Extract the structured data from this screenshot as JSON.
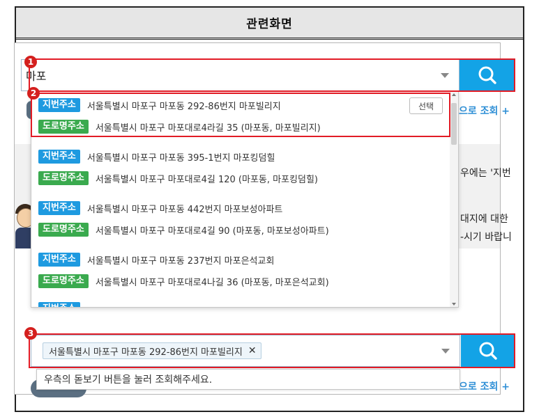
{
  "header": {
    "title": "관련화면"
  },
  "search": {
    "query": "마포"
  },
  "markers": [
    "1",
    "2",
    "3"
  ],
  "results": [
    {
      "jibun_label": "지번주소",
      "jibun": "서울특별시 마포구 마포동 292-86번지 마포빌리지",
      "doro_label": "도로명주소",
      "doro": "서울특별시 마포구 마포대로4라길 35 (마포동, 마포빌리지)",
      "select_label": "선택"
    },
    {
      "jibun_label": "지번주소",
      "jibun": "서울특별시 마포구 마포동 395-1번지 마포킹덤힐",
      "doro_label": "도로명주소",
      "doro": "서울특별시 마포구 마포대로4길 120 (마포동, 마포킹덤힐)"
    },
    {
      "jibun_label": "지번주소",
      "jibun": "서울특별시 마포구 마포동 442번지 마포보성아파트",
      "doro_label": "도로명주소",
      "doro": "서울특별시 마포구 마포대로4길 90 (마포동, 마포보성아파트)"
    },
    {
      "jibun_label": "지번주소",
      "jibun": "서울특별시 마포구 마포동 237번지 마포은석교회",
      "doro_label": "도로명주소",
      "doro": "서울특별시 마포구 마포대로4나길 36 (마포동, 마포은석교회)"
    },
    {
      "jibun_label": "지번주소"
    }
  ],
  "background": {
    "link_top": "으로 조회 +",
    "link_bottom": "으로 조회 +",
    "text_1": "우에는 '지번",
    "text_2": "대지에 대한",
    "text_3": "-시기 바랍니"
  },
  "selected": {
    "tag": "서울특별시 마포구 마포동 292-86번지 마포빌리지",
    "remove_glyph": "✕",
    "hint": "우측의 돋보기 버튼을 눌러 조회해주세요."
  },
  "colors": {
    "accent": "#13a3e6",
    "jibun_badge": "#1e9ae0",
    "doro_badge": "#3aaa4e",
    "highlight": "#e21b25"
  }
}
